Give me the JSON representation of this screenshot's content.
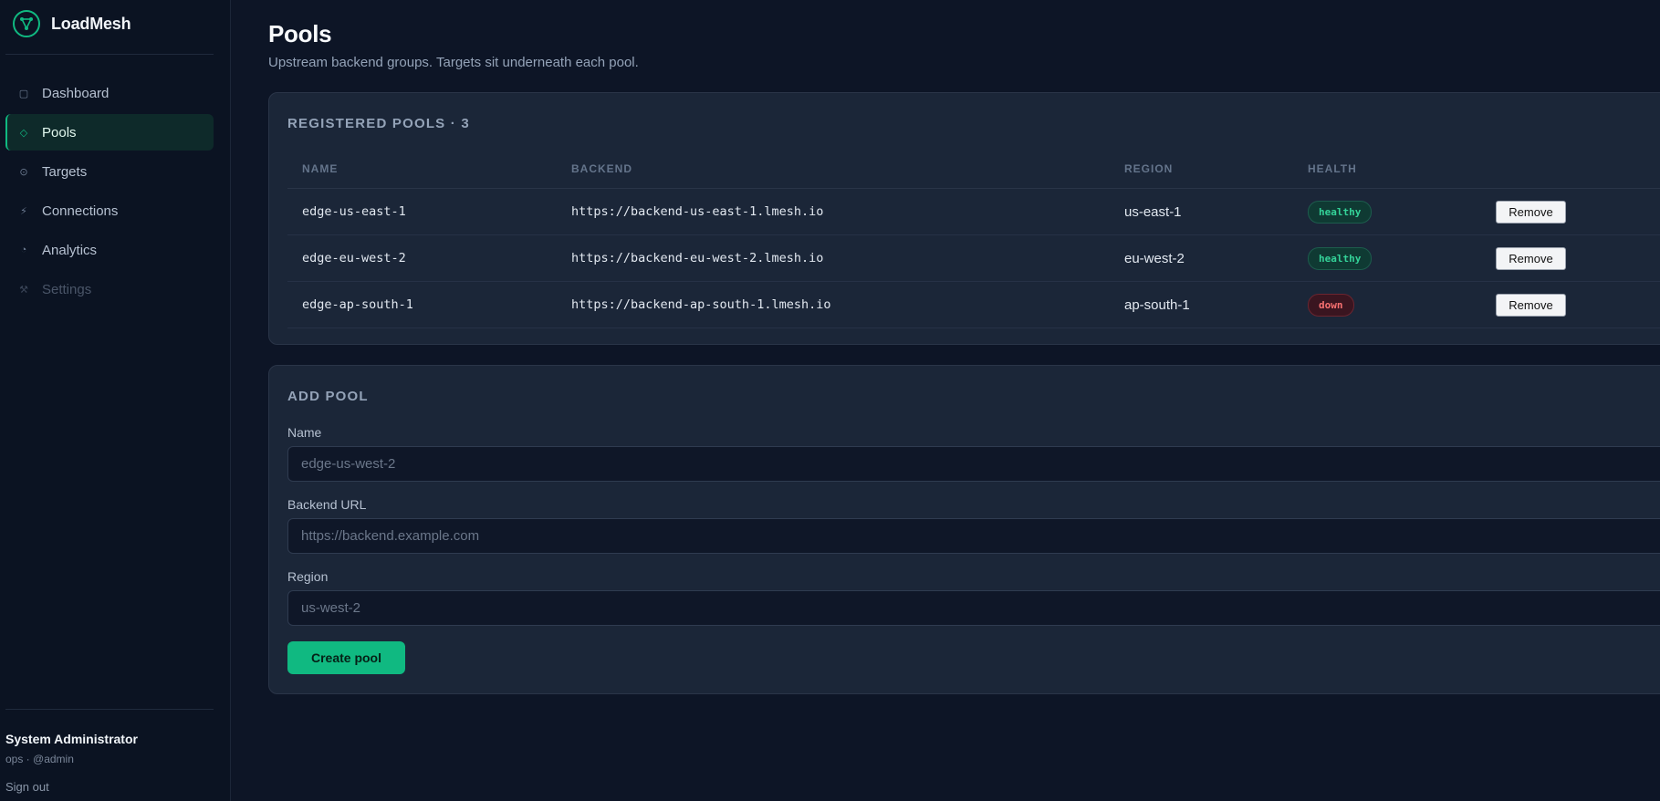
{
  "app": {
    "name": "LoadMesh"
  },
  "sidebar": {
    "items": [
      {
        "label": "Dashboard",
        "icon": "square-icon",
        "glyph": "▢"
      },
      {
        "label": "Pools",
        "icon": "diamond-icon",
        "glyph": "◇"
      },
      {
        "label": "Targets",
        "icon": "target-icon",
        "glyph": "⊙"
      },
      {
        "label": "Connections",
        "icon": "plug-icon",
        "glyph": "⚡"
      },
      {
        "label": "Analytics",
        "icon": "chart-icon",
        "glyph": "◔"
      },
      {
        "label": "Settings",
        "icon": "wrench-icon",
        "glyph": "⚒"
      }
    ],
    "active": "Pools",
    "user": {
      "name": "System Administrator",
      "sub": "ops · @admin"
    },
    "signout": "Sign out"
  },
  "page": {
    "title": "Pools",
    "subtitle": "Upstream backend groups. Targets sit underneath each pool."
  },
  "pools": {
    "title": "REGISTERED POOLS · 3",
    "columns": [
      "NAME",
      "BACKEND",
      "REGION",
      "HEALTH"
    ],
    "rows": [
      {
        "name": "edge-us-east-1",
        "backend": "https://backend-us-east-1.lmesh.io",
        "region": "us-east-1",
        "health": "healthy",
        "action": "Remove"
      },
      {
        "name": "edge-eu-west-2",
        "backend": "https://backend-eu-west-2.lmesh.io",
        "region": "eu-west-2",
        "health": "healthy",
        "action": "Remove"
      },
      {
        "name": "edge-ap-south-1",
        "backend": "https://backend-ap-south-1.lmesh.io",
        "region": "ap-south-1",
        "health": "down",
        "action": "Remove"
      }
    ]
  },
  "add_pool": {
    "title": "ADD POOL",
    "name_label": "Name",
    "name_placeholder": "edge-us-west-2",
    "url_label": "Backend URL",
    "url_placeholder": "https://backend.example.com",
    "region_label": "Region",
    "region_placeholder": "us-west-2",
    "submit": "Create pool"
  },
  "colors": {
    "accent": "#10b981",
    "healthy": "#34d399",
    "down": "#f87171"
  }
}
